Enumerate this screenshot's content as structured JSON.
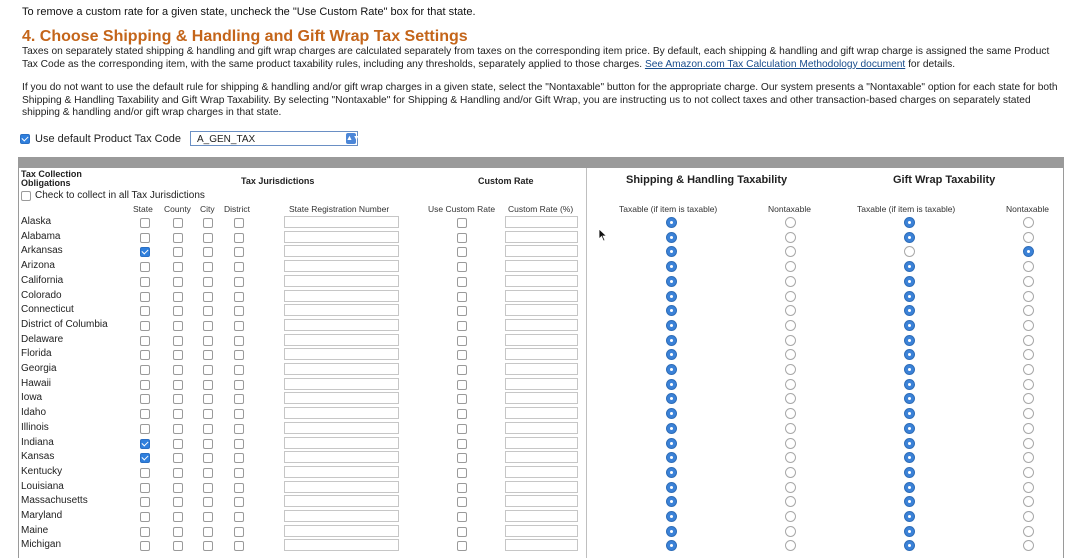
{
  "intro": "To remove a custom rate for a given state, uncheck the \"Use Custom Rate\" box for that state.",
  "section_title": "4. Choose Shipping & Handling and Gift Wrap Tax Settings",
  "paragraph1": "Taxes on separately stated shipping & handling and gift wrap charges are calculated separately from taxes on the corresponding item price. By default, each shipping & handling and gift wrap charge is assigned the same Product Tax Code as the corresponding item, with the same product taxability rules, including any thresholds, separately applied to those charges.",
  "paragraph1_link": "See Amazon.com Tax Calculation Methodology document",
  "paragraph1_tail": "for details.",
  "paragraph2": "If you do not want to use the default rule for shipping & handling and/or gift wrap charges in a given state, select the \"Nontaxable\" button for the appropriate charge. Our system presents a \"Nontaxable\" option for each state for both Shipping & Handling Taxability and Gift Wrap Taxability. By selecting \"Nontaxable\" for Shipping & Handling and/or Gift Wrap, you are instructing us to not collect taxes and other transaction-based charges on separately stated shipping & handling and/or gift wrap charges in that state.",
  "default_code": {
    "label": "Use default Product Tax Code",
    "checked": true,
    "selected_value": "A_GEN_TAX"
  },
  "table": {
    "col_tax_collection": "Tax Collection Obligations",
    "col_tax_jurisdictions": "Tax Jurisdictions",
    "col_custom_rate": "Custom Rate",
    "col_shipping": "Shipping & Handling Taxability",
    "col_gift_wrap": "Gift Wrap Taxability",
    "check_all_label": "Check to collect in all Tax Jurisdictions",
    "sub_state": "State",
    "sub_county": "County",
    "sub_city": "City",
    "sub_district": "District",
    "sub_registration": "State Registration Number",
    "sub_use_custom": "Use Custom Rate",
    "sub_custom_pct": "Custom Rate (%)",
    "sub_taxable": "Taxable (if item is taxable)",
    "sub_nontaxable": "Nontaxable",
    "sub_gw_taxable": "Taxable (if item is taxable)",
    "sub_gw_nontaxable": "Nontaxable"
  },
  "states": [
    {
      "name": "Alaska",
      "state_checked": false,
      "gift_nontaxable": false
    },
    {
      "name": "Alabama",
      "state_checked": false,
      "gift_nontaxable": false
    },
    {
      "name": "Arkansas",
      "state_checked": true,
      "gift_nontaxable": true
    },
    {
      "name": "Arizona",
      "state_checked": false,
      "gift_nontaxable": false
    },
    {
      "name": "California",
      "state_checked": false,
      "gift_nontaxable": false
    },
    {
      "name": "Colorado",
      "state_checked": false,
      "gift_nontaxable": false
    },
    {
      "name": "Connecticut",
      "state_checked": false,
      "gift_nontaxable": false
    },
    {
      "name": "District of Columbia",
      "state_checked": false,
      "gift_nontaxable": false
    },
    {
      "name": "Delaware",
      "state_checked": false,
      "gift_nontaxable": false
    },
    {
      "name": "Florida",
      "state_checked": false,
      "gift_nontaxable": false
    },
    {
      "name": "Georgia",
      "state_checked": false,
      "gift_nontaxable": false
    },
    {
      "name": "Hawaii",
      "state_checked": false,
      "gift_nontaxable": false
    },
    {
      "name": "Iowa",
      "state_checked": false,
      "gift_nontaxable": false
    },
    {
      "name": "Idaho",
      "state_checked": false,
      "gift_nontaxable": false
    },
    {
      "name": "Illinois",
      "state_checked": false,
      "gift_nontaxable": false
    },
    {
      "name": "Indiana",
      "state_checked": true,
      "gift_nontaxable": false
    },
    {
      "name": "Kansas",
      "state_checked": true,
      "gift_nontaxable": false
    },
    {
      "name": "Kentucky",
      "state_checked": false,
      "gift_nontaxable": false
    },
    {
      "name": "Louisiana",
      "state_checked": false,
      "gift_nontaxable": false
    },
    {
      "name": "Massachusetts",
      "state_checked": false,
      "gift_nontaxable": false
    },
    {
      "name": "Maryland",
      "state_checked": false,
      "gift_nontaxable": false
    },
    {
      "name": "Maine",
      "state_checked": false,
      "gift_nontaxable": false
    },
    {
      "name": "Michigan",
      "state_checked": false,
      "gift_nontaxable": false
    }
  ]
}
